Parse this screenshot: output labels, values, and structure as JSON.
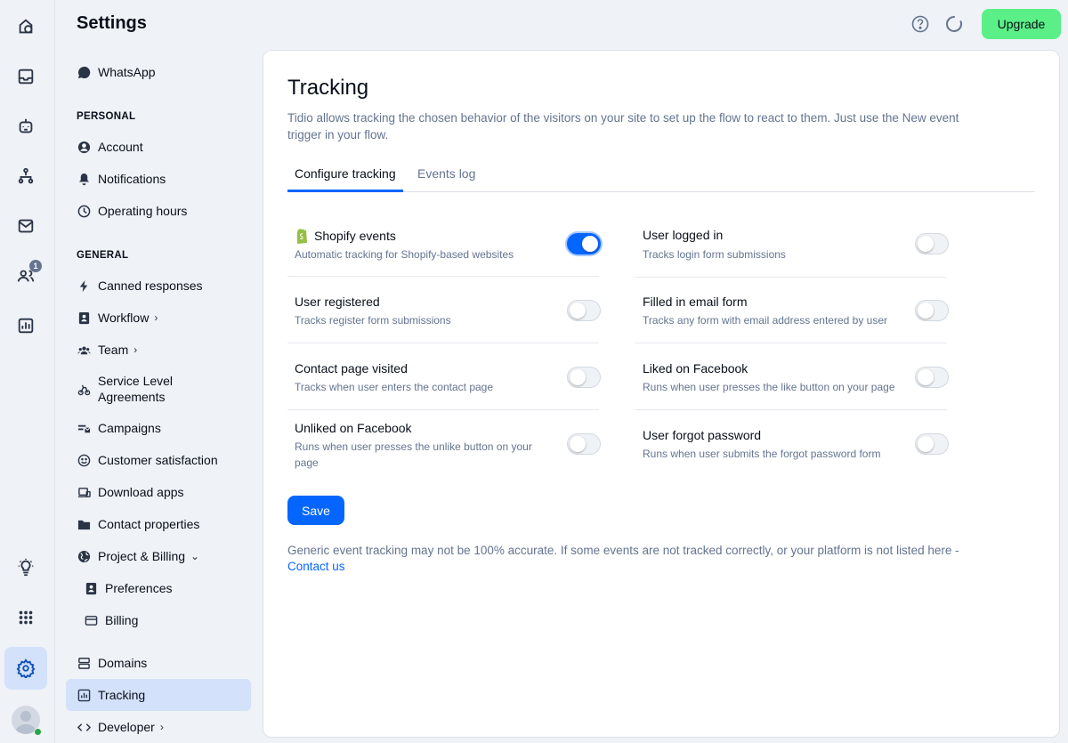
{
  "app": {
    "title": "Settings",
    "accent": "#0566ff",
    "upgrade_color": "#5af087"
  },
  "rail": {
    "items": [
      {
        "icon": "home-icon"
      },
      {
        "icon": "inbox-icon"
      },
      {
        "icon": "bot-icon"
      },
      {
        "icon": "flows-icon"
      },
      {
        "icon": "mail-icon"
      },
      {
        "icon": "contacts-icon",
        "badge": "1"
      },
      {
        "icon": "analytics-icon"
      },
      {
        "icon": "lightbulb-icon"
      },
      {
        "icon": "apps-icon"
      },
      {
        "icon": "settings-icon"
      }
    ]
  },
  "top": {
    "upgrade_label": "Upgrade"
  },
  "sidebar": {
    "whatsapp": "WhatsApp",
    "personal_head": "PERSONAL",
    "account": "Account",
    "notifications": "Notifications",
    "operating_hours": "Operating hours",
    "general_head": "GENERAL",
    "canned": "Canned responses",
    "workflow": "Workflow",
    "team": "Team",
    "sla": "Service Level Agreements",
    "campaigns": "Campaigns",
    "satisfaction": "Customer satisfaction",
    "download_apps": "Download apps",
    "contact_properties": "Contact properties",
    "project_billing": "Project & Billing",
    "preferences": "Preferences",
    "billing": "Billing",
    "domains": "Domains",
    "tracking": "Tracking",
    "developer": "Developer"
  },
  "main": {
    "title": "Tracking",
    "description": "Tidio allows tracking the chosen behavior of the visitors on your site to set up the flow to react to them. Just use the New event trigger in your flow.",
    "tabs": [
      "Configure tracking",
      "Events log"
    ],
    "events": [
      {
        "title": "Shopify events",
        "subtitle": "Automatic tracking for Shopify-based websites",
        "enabled": true
      },
      {
        "title": "User logged in",
        "subtitle": "Tracks login form submissions",
        "enabled": false
      },
      {
        "title": "User registered",
        "subtitle": "Tracks register form submissions",
        "enabled": false
      },
      {
        "title": "Filled in email form",
        "subtitle": "Tracks any form with email address entered by user",
        "enabled": false
      },
      {
        "title": "Contact page visited",
        "subtitle": "Tracks when user enters the contact page",
        "enabled": false
      },
      {
        "title": "Liked on Facebook",
        "subtitle": "Runs when user presses the like button on your page",
        "enabled": false
      },
      {
        "title": "Unliked on Facebook",
        "subtitle": "Runs when user presses the unlike button on your page",
        "enabled": false
      },
      {
        "title": "User forgot password",
        "subtitle": "Runs when user submits the forgot password form",
        "enabled": false
      }
    ],
    "save_label": "Save",
    "footer_text": "Generic event tracking may not be 100% accurate. If some events are not tracked correctly, or your platform is not listed here - ",
    "footer_link": "Contact us"
  }
}
